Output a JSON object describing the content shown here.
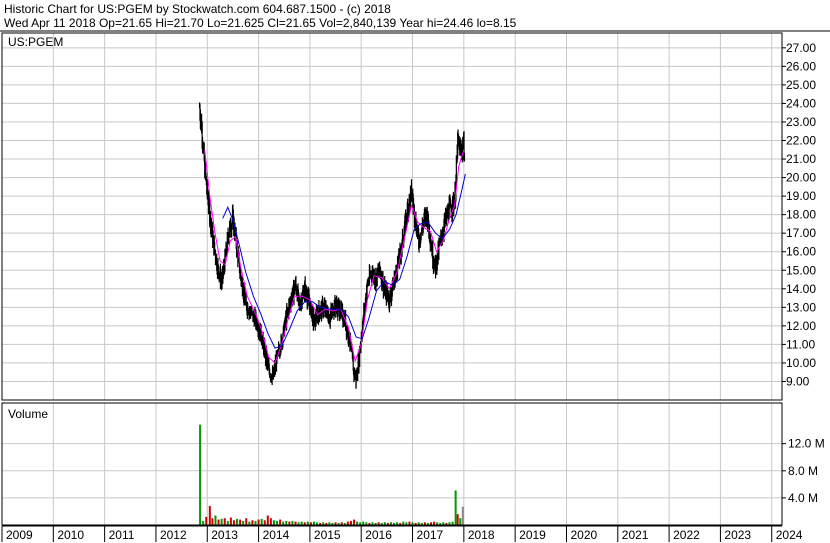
{
  "header": {
    "line1": "Historic Chart for US:PGEM by Stockwatch.com 604.687.1500 - (c) 2018",
    "line2": "Wed Apr 11 2018   Op=21.65  Hi=21.70  Lo=21.625  Cl=21.65  Vol=2,840,139   Year hi=24.46  lo=8.15"
  },
  "chart_data": {
    "type": "candlestick_with_volume",
    "symbol_label": "US:PGEM",
    "volume_label": "Volume",
    "price_axis": {
      "ticks": [
        "9.00",
        "10.00",
        "11.00",
        "12.00",
        "13.00",
        "14.00",
        "15.00",
        "16.00",
        "17.00",
        "18.00",
        "19.00",
        "20.00",
        "21.00",
        "22.00",
        "23.00",
        "24.00",
        "25.00",
        "26.00",
        "27.00"
      ],
      "range": [
        8.0,
        27.8
      ]
    },
    "volume_axis": {
      "ticks": [
        "4.0 M",
        "8.0 M",
        "12.0 M"
      ],
      "tick_values": [
        4,
        8,
        12
      ],
      "range": [
        0,
        18
      ]
    },
    "x_axis": {
      "years": [
        "2009",
        "2010",
        "2011",
        "2012",
        "2013",
        "2014",
        "2015",
        "2016",
        "2017",
        "2018",
        "2019",
        "2020",
        "2021",
        "2022",
        "2023",
        "2024"
      ],
      "range": [
        2009.0,
        2024.2
      ]
    },
    "price_series": {
      "name": "",
      "points": [
        [
          2012.85,
          23.8
        ],
        [
          2012.9,
          22.5
        ],
        [
          2012.95,
          20.5
        ],
        [
          2013.0,
          19.2
        ],
        [
          2013.05,
          18.0
        ],
        [
          2013.12,
          16.5
        ],
        [
          2013.2,
          15.2
        ],
        [
          2013.28,
          14.3
        ],
        [
          2013.35,
          15.6
        ],
        [
          2013.42,
          17.1
        ],
        [
          2013.5,
          17.8
        ],
        [
          2013.58,
          16.2
        ],
        [
          2013.66,
          14.5
        ],
        [
          2013.75,
          13.2
        ],
        [
          2013.85,
          12.7
        ],
        [
          2013.95,
          12.3
        ],
        [
          2014.05,
          11.5
        ],
        [
          2014.12,
          10.6
        ],
        [
          2014.2,
          9.6
        ],
        [
          2014.28,
          9.2
        ],
        [
          2014.35,
          10.2
        ],
        [
          2014.45,
          11.2
        ],
        [
          2014.55,
          12.6
        ],
        [
          2014.65,
          13.6
        ],
        [
          2014.72,
          14.2
        ],
        [
          2014.8,
          13.1
        ],
        [
          2014.9,
          14.0
        ],
        [
          2014.98,
          13.3
        ],
        [
          2015.08,
          12.2
        ],
        [
          2015.18,
          12.8
        ],
        [
          2015.28,
          13.0
        ],
        [
          2015.38,
          12.4
        ],
        [
          2015.48,
          13.1
        ],
        [
          2015.58,
          12.9
        ],
        [
          2015.68,
          12.3
        ],
        [
          2015.78,
          11.2
        ],
        [
          2015.85,
          9.6
        ],
        [
          2015.9,
          9.1
        ],
        [
          2015.97,
          10.6
        ],
        [
          2016.05,
          12.6
        ],
        [
          2016.12,
          14.2
        ],
        [
          2016.2,
          14.9
        ],
        [
          2016.28,
          14.5
        ],
        [
          2016.36,
          15.1
        ],
        [
          2016.45,
          14.0
        ],
        [
          2016.55,
          13.4
        ],
        [
          2016.62,
          14.2
        ],
        [
          2016.7,
          15.1
        ],
        [
          2016.78,
          16.1
        ],
        [
          2016.85,
          17.3
        ],
        [
          2016.92,
          18.6
        ],
        [
          2016.98,
          19.2
        ],
        [
          2017.05,
          17.8
        ],
        [
          2017.12,
          16.6
        ],
        [
          2017.2,
          17.4
        ],
        [
          2017.27,
          18.1
        ],
        [
          2017.33,
          17.2
        ],
        [
          2017.4,
          15.6
        ],
        [
          2017.45,
          15.2
        ],
        [
          2017.52,
          16.2
        ],
        [
          2017.58,
          17.0
        ],
        [
          2017.65,
          17.8
        ],
        [
          2017.72,
          18.3
        ],
        [
          2017.78,
          18.5
        ],
        [
          2017.83,
          19.0
        ],
        [
          2017.88,
          21.8
        ],
        [
          2017.93,
          21.5
        ],
        [
          2017.98,
          21.6
        ],
        [
          2018.02,
          21.6
        ]
      ]
    },
    "moving_averages": [
      {
        "name": "",
        "color": "#ff00ff",
        "points": [
          [
            2012.95,
            21.5
          ],
          [
            2013.05,
            19.0
          ],
          [
            2013.15,
            17.0
          ],
          [
            2013.25,
            15.5
          ],
          [
            2013.35,
            15.3
          ],
          [
            2013.45,
            16.6
          ],
          [
            2013.55,
            16.8
          ],
          [
            2013.65,
            15.2
          ],
          [
            2013.78,
            13.6
          ],
          [
            2013.95,
            12.6
          ],
          [
            2014.08,
            11.6
          ],
          [
            2014.2,
            10.3
          ],
          [
            2014.32,
            10.0
          ],
          [
            2014.45,
            11.0
          ],
          [
            2014.58,
            12.4
          ],
          [
            2014.7,
            13.6
          ],
          [
            2014.85,
            13.6
          ],
          [
            2015.0,
            13.4
          ],
          [
            2015.15,
            12.6
          ],
          [
            2015.3,
            12.9
          ],
          [
            2015.45,
            12.8
          ],
          [
            2015.6,
            12.9
          ],
          [
            2015.75,
            11.9
          ],
          [
            2015.88,
            10.1
          ],
          [
            2016.0,
            11.0
          ],
          [
            2016.12,
            13.4
          ],
          [
            2016.25,
            14.7
          ],
          [
            2016.4,
            14.6
          ],
          [
            2016.55,
            14.0
          ],
          [
            2016.7,
            14.9
          ],
          [
            2016.85,
            16.8
          ],
          [
            2016.98,
            18.5
          ],
          [
            2017.1,
            17.6
          ],
          [
            2017.22,
            17.3
          ],
          [
            2017.35,
            17.1
          ],
          [
            2017.47,
            16.0
          ],
          [
            2017.6,
            16.6
          ],
          [
            2017.72,
            17.8
          ],
          [
            2017.82,
            18.5
          ],
          [
            2017.9,
            20.6
          ],
          [
            2018.0,
            21.5
          ]
        ]
      },
      {
        "name": "",
        "color": "#0000cc",
        "points": [
          [
            2013.3,
            17.8
          ],
          [
            2013.4,
            18.4
          ],
          [
            2013.5,
            17.7
          ],
          [
            2013.62,
            16.4
          ],
          [
            2013.75,
            14.9
          ],
          [
            2013.9,
            13.6
          ],
          [
            2014.05,
            12.6
          ],
          [
            2014.18,
            11.6
          ],
          [
            2014.32,
            10.8
          ],
          [
            2014.45,
            10.9
          ],
          [
            2014.6,
            11.8
          ],
          [
            2014.75,
            12.8
          ],
          [
            2014.9,
            13.3
          ],
          [
            2015.05,
            13.3
          ],
          [
            2015.2,
            13.0
          ],
          [
            2015.4,
            12.9
          ],
          [
            2015.6,
            12.9
          ],
          [
            2015.75,
            12.5
          ],
          [
            2015.9,
            11.4
          ],
          [
            2016.02,
            11.3
          ],
          [
            2016.15,
            12.4
          ],
          [
            2016.3,
            13.9
          ],
          [
            2016.45,
            14.4
          ],
          [
            2016.6,
            14.2
          ],
          [
            2016.75,
            14.5
          ],
          [
            2016.9,
            15.8
          ],
          [
            2017.03,
            17.2
          ],
          [
            2017.15,
            17.5
          ],
          [
            2017.3,
            17.6
          ],
          [
            2017.45,
            17.0
          ],
          [
            2017.58,
            16.7
          ],
          [
            2017.72,
            17.2
          ],
          [
            2017.85,
            18.0
          ],
          [
            2017.95,
            19.2
          ],
          [
            2018.03,
            20.2
          ]
        ]
      }
    ],
    "volume_series": {
      "bars": [
        [
          2012.86,
          14.8,
          "#009900"
        ],
        [
          2012.92,
          0.6,
          "#009900"
        ],
        [
          2012.98,
          1.2,
          "#cc0000"
        ],
        [
          2013.05,
          2.8,
          "#cc0000"
        ],
        [
          2013.1,
          1.0,
          "#cc0000"
        ],
        [
          2013.16,
          1.4,
          "#009900"
        ],
        [
          2013.22,
          0.8,
          "#cc0000"
        ],
        [
          2013.28,
          0.9,
          "#009900"
        ],
        [
          2013.34,
          1.0,
          "#cc0000"
        ],
        [
          2013.4,
          0.6,
          "#009900"
        ],
        [
          2013.46,
          1.1,
          "#cc0000"
        ],
        [
          2013.52,
          0.7,
          "#cc0000"
        ],
        [
          2013.58,
          0.9,
          "#009900"
        ],
        [
          2013.64,
          0.8,
          "#cc0000"
        ],
        [
          2013.7,
          0.6,
          "#009900"
        ],
        [
          2013.76,
          1.0,
          "#cc0000"
        ],
        [
          2013.82,
          0.5,
          "#009900"
        ],
        [
          2013.88,
          0.7,
          "#cc0000"
        ],
        [
          2013.94,
          0.6,
          "#009900"
        ],
        [
          2014.0,
          0.8,
          "#cc0000"
        ],
        [
          2014.06,
          0.9,
          "#009900"
        ],
        [
          2014.12,
          0.7,
          "#cc0000"
        ],
        [
          2014.18,
          1.4,
          "#cc0000"
        ],
        [
          2014.24,
          1.0,
          "#cc0000"
        ],
        [
          2014.3,
          0.7,
          "#009900"
        ],
        [
          2014.36,
          0.6,
          "#009900"
        ],
        [
          2014.42,
          0.8,
          "#cc0000"
        ],
        [
          2014.48,
          0.5,
          "#009900"
        ],
        [
          2014.54,
          0.6,
          "#009900"
        ],
        [
          2014.6,
          0.5,
          "#cc0000"
        ],
        [
          2014.66,
          0.6,
          "#009900"
        ],
        [
          2014.72,
          0.5,
          "#cc0000"
        ],
        [
          2014.78,
          0.4,
          "#009900"
        ],
        [
          2014.84,
          0.5,
          "#009900"
        ],
        [
          2014.9,
          0.4,
          "#cc0000"
        ],
        [
          2014.96,
          0.5,
          "#009900"
        ],
        [
          2015.02,
          0.4,
          "#cc0000"
        ],
        [
          2015.08,
          0.5,
          "#009900"
        ],
        [
          2015.14,
          0.4,
          "#009900"
        ],
        [
          2015.2,
          0.3,
          "#cc0000"
        ],
        [
          2015.26,
          0.4,
          "#009900"
        ],
        [
          2015.32,
          0.3,
          "#cc0000"
        ],
        [
          2015.38,
          0.4,
          "#009900"
        ],
        [
          2015.44,
          0.3,
          "#009900"
        ],
        [
          2015.5,
          0.4,
          "#cc0000"
        ],
        [
          2015.56,
          0.3,
          "#009900"
        ],
        [
          2015.62,
          0.4,
          "#cc0000"
        ],
        [
          2015.68,
          0.3,
          "#009900"
        ],
        [
          2015.74,
          0.5,
          "#cc0000"
        ],
        [
          2015.8,
          0.6,
          "#cc0000"
        ],
        [
          2015.86,
          0.8,
          "#cc0000"
        ],
        [
          2015.92,
          0.5,
          "#009900"
        ],
        [
          2015.98,
          0.4,
          "#009900"
        ],
        [
          2016.04,
          0.5,
          "#009900"
        ],
        [
          2016.1,
          0.4,
          "#009900"
        ],
        [
          2016.16,
          0.3,
          "#cc0000"
        ],
        [
          2016.22,
          0.4,
          "#009900"
        ],
        [
          2016.28,
          0.3,
          "#009900"
        ],
        [
          2016.34,
          0.4,
          "#cc0000"
        ],
        [
          2016.4,
          0.3,
          "#009900"
        ],
        [
          2016.46,
          0.4,
          "#009900"
        ],
        [
          2016.52,
          0.3,
          "#cc0000"
        ],
        [
          2016.58,
          0.4,
          "#009900"
        ],
        [
          2016.64,
          0.3,
          "#009900"
        ],
        [
          2016.7,
          0.4,
          "#009900"
        ],
        [
          2016.76,
          0.3,
          "#cc0000"
        ],
        [
          2016.82,
          0.5,
          "#009900"
        ],
        [
          2016.88,
          0.4,
          "#009900"
        ],
        [
          2016.94,
          0.5,
          "#cc0000"
        ],
        [
          2017.0,
          0.4,
          "#009900"
        ],
        [
          2017.06,
          0.3,
          "#cc0000"
        ],
        [
          2017.12,
          0.4,
          "#009900"
        ],
        [
          2017.18,
          0.3,
          "#009900"
        ],
        [
          2017.24,
          0.4,
          "#cc0000"
        ],
        [
          2017.3,
          0.3,
          "#009900"
        ],
        [
          2017.36,
          0.4,
          "#cc0000"
        ],
        [
          2017.42,
          0.5,
          "#cc0000"
        ],
        [
          2017.48,
          0.4,
          "#009900"
        ],
        [
          2017.54,
          0.3,
          "#009900"
        ],
        [
          2017.6,
          0.4,
          "#009900"
        ],
        [
          2017.66,
          0.3,
          "#cc0000"
        ],
        [
          2017.72,
          0.4,
          "#009900"
        ],
        [
          2017.78,
          0.5,
          "#009900"
        ],
        [
          2017.84,
          5.1,
          "#009900"
        ],
        [
          2017.88,
          1.6,
          "#cc0000"
        ],
        [
          2017.93,
          1.0,
          "#009900"
        ],
        [
          2017.98,
          2.7,
          "#888888"
        ]
      ]
    },
    "colors": {
      "candle": "#000000",
      "up_volume": "#009900",
      "down_volume": "#cc0000",
      "grid": "#c8c8c8"
    },
    "grid": true
  }
}
